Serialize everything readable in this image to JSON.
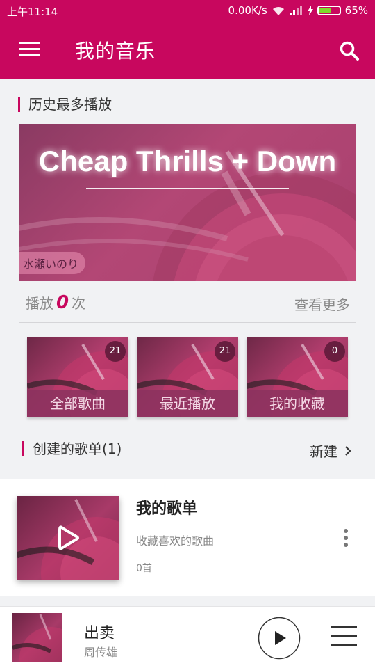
{
  "status_bar": {
    "time": "上午11:14",
    "speed": "0.00K/s",
    "battery_percent": "65%",
    "battery_level": 0.65
  },
  "app_bar": {
    "title": "我的音乐",
    "menu_icon": "menu-icon",
    "search_icon": "search-icon"
  },
  "history": {
    "section_title": "历史最多播放",
    "banner_title": "Cheap Thrills + Down",
    "banner_artist": "水瀬いのり",
    "play_label": "播放",
    "play_count": "0",
    "play_unit": "次",
    "see_more": "查看更多"
  },
  "categories": [
    {
      "label": "全部歌曲",
      "badge": "21"
    },
    {
      "label": "最近播放",
      "badge": "21"
    },
    {
      "label": "我的收藏",
      "badge": "0"
    }
  ],
  "created_playlists": {
    "section_title": "创建的歌单(1)",
    "new_label": "新建",
    "items": [
      {
        "name": "我的歌单",
        "description": "收藏喜欢的歌曲",
        "count": "0首"
      }
    ]
  },
  "now_playing": {
    "title": "出卖",
    "artist": "周传雄"
  },
  "colors": {
    "accent": "#c8075e",
    "card_overlay": "#8c325f"
  }
}
